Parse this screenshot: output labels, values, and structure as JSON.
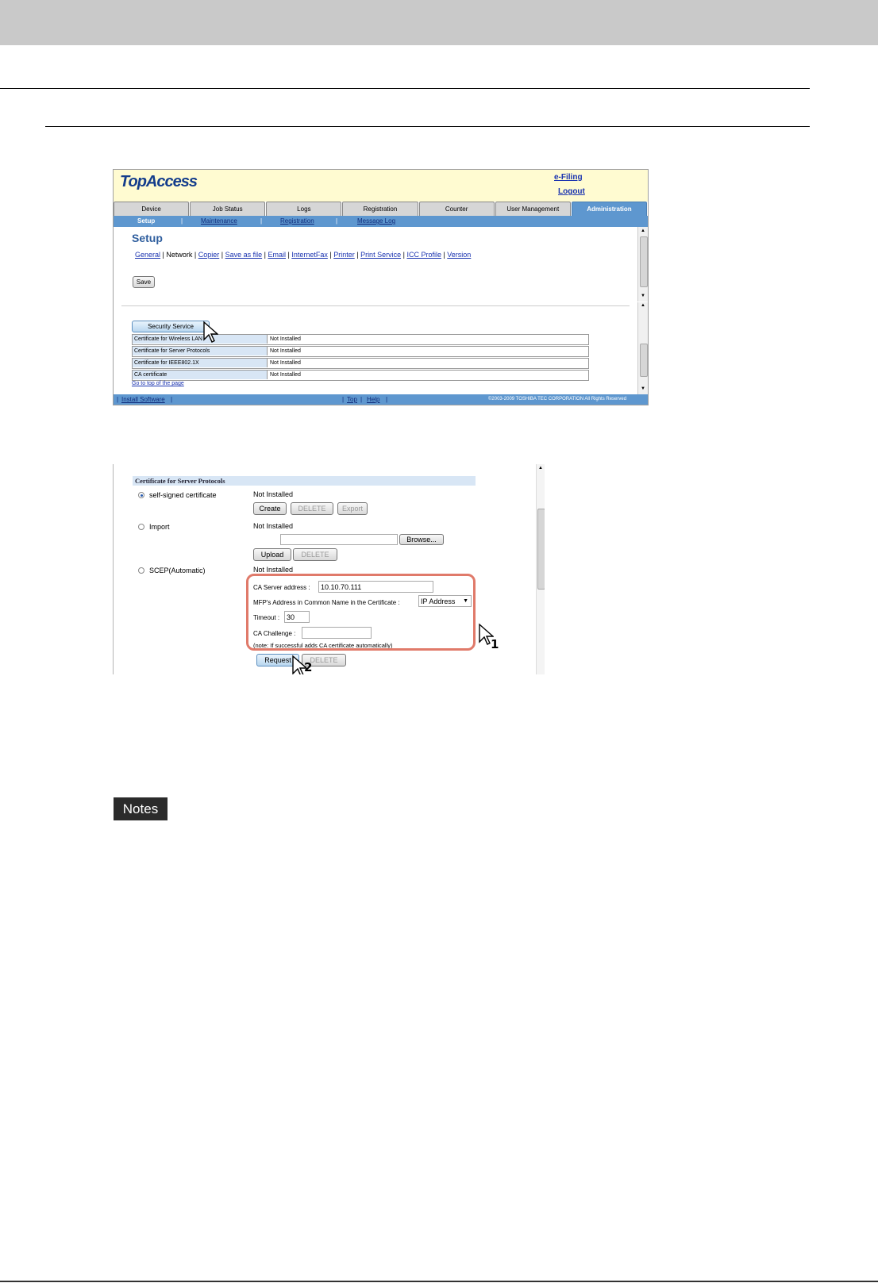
{
  "screenshot1": {
    "logo": "TopAccess",
    "header_links": [
      "e-Filing",
      "Logout"
    ],
    "tabs": [
      "Device",
      "Job Status",
      "Logs",
      "Registration",
      "Counter",
      "User Management",
      "Administration"
    ],
    "subnav": [
      "Setup",
      "Maintenance",
      "Registration",
      "Message Log"
    ],
    "page_title": "Setup",
    "setup_links": [
      "General",
      "Network",
      "Copier",
      "Save as file",
      "Email",
      "InternetFax",
      "Printer",
      "Print Service",
      "ICC Profile",
      "Version"
    ],
    "save_label": "Save",
    "security_label": "Security Service",
    "cert_rows": [
      {
        "name": "Certificate for Wireless LAN",
        "status": "Not Installed"
      },
      {
        "name": "Certificate for Server Protocols",
        "status": "Not Installed"
      },
      {
        "name": "Certificate for IEEE802.1X",
        "status": "Not Installed"
      },
      {
        "name": "CA certificate",
        "status": "Not Installed"
      }
    ],
    "top_link": "Go to top of the page",
    "footer": {
      "install": "Install Software",
      "top": "Top",
      "help": "Help",
      "copyright": "©2003-2009 TOSHIBA TEC CORPORATION All Rights Reserved"
    }
  },
  "screenshot2": {
    "section_title": "Certificate for Server Protocols",
    "self_signed": {
      "label": "self-signed certificate",
      "status": "Not Installed",
      "buttons": [
        "Create",
        "DELETE",
        "Export"
      ]
    },
    "import": {
      "label": "Import",
      "status": "Not Installed",
      "browse": "Browse...",
      "buttons": [
        "Upload",
        "DELETE"
      ]
    },
    "scep": {
      "label": "SCEP(Automatic)",
      "status": "Not Installed",
      "ca_server_label": "CA Server address",
      "ca_server_value": "10.10.70.111",
      "mfp_label": "MFP's Address in Common Name in the Certificate",
      "mfp_value": "IP Address",
      "timeout_label": "Timeout",
      "timeout_value": "30",
      "challenge_label": "CA Challenge",
      "note": "(note: If successful adds CA certificate automatically)",
      "buttons": [
        "Request",
        "DELETE"
      ]
    },
    "callouts": [
      "1",
      "2"
    ]
  },
  "notes_label": "Notes"
}
